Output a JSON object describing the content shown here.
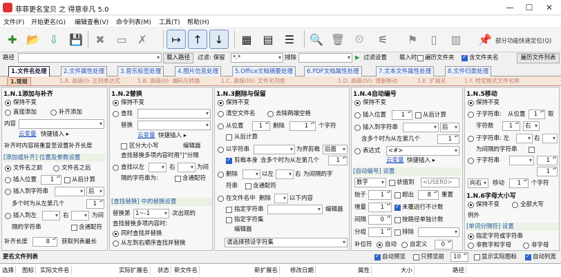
{
  "title": "菲菲更名宝贝 之 得意非凡 5.0",
  "menu": [
    "文件(F)",
    "开始更名(G)",
    "编辑查看(V)",
    "命令列表(M)",
    "工具(T)",
    "帮助(H)"
  ],
  "toolbar_right": "部分功能快速定位(Q)",
  "path": {
    "label": "路径",
    "value": "",
    "load": "载入路径",
    "filter_label": "过滤: 保留",
    "filter_value": "*.*",
    "exclude_label": "排除",
    "filter_settings": "过滤设置",
    "load_time": "载入时:",
    "opt1": "遍历文件夹",
    "opt2": "含文件夹名",
    "list_btn": "遍历文件列表"
  },
  "tabs1": [
    "1.文件名处理",
    "2.文件属性处理",
    "3.音乐标签处理",
    "4.图片信息处理",
    "5.Office文档摘要处理",
    "6.PDF文档属性处理",
    "7.文本文件属性处理",
    "8.文件归类处理"
  ],
  "tabs2": [
    "1.常规",
    "1.A. 高级(I): 正则表达式",
    "1.B. 高级(II): 编码与转换",
    "1.C. 高级(III): 文件名列表",
    "1.D. 高级(IV): 增删移动",
    "1.E. 扩展名",
    "1.F. 特定格式文件名称"
  ],
  "p1": {
    "h": "1.N.1添加与补齐",
    "r1": "保持不变",
    "r2": "直接添加",
    "r3": "补齐添加",
    "content": "内容",
    "link": "云变量",
    "quick": "快捷插入 ▸",
    "note": "补齐时内容将重复至设置补齐长度",
    "sec": "[添加或补齐] 位置及参数设置",
    "pos1": "文件名之前",
    "pos2": "文件名之后",
    "ins_pos": "插入位置",
    "v1": "1",
    "from_calc": "从后计算",
    "ins_str": "插入到字符串",
    "after": "后",
    "multi": "多个时为从左第几个",
    "v2": "1",
    "ins_to": "插入到左",
    "right": "右",
    "interval": "隔的字符串",
    "regex": "含通配符",
    "pad_len": "补齐长度",
    "v3": "8",
    "get_max": "获取列表最长"
  },
  "p2": {
    "h": "1.N.2替换",
    "r1": "保持不变",
    "r2": "查找",
    "rep": "替换",
    "link": "云变量",
    "quick": "快捷插入 ▸",
    "case": "区分大小写",
    "editor": "编辑器",
    "multi": "查找替换多项内容时用\"|\"分隔",
    "find_left": "查找以左",
    "right": "右",
    "interval_for": "为间",
    "interval": "隔的字符串为:",
    "regex": "含通配符",
    "sec": "[查找替换] 中的替换设置",
    "rep_n": "替换第",
    "rep_v": "1~-1",
    "times": "次出现的",
    "multi2": "查找替换多项内容时:",
    "o1": "同时查找并替换",
    "o2": "从左到右顺序查找并替换"
  },
  "p3": {
    "h": "1.N.3删除与保留",
    "r1": "保持不变",
    "c1": "清空文件名",
    "c2": "去除两端空格",
    "from_pos": "从位置",
    "v1": "1",
    "del": "删除",
    "v2": "1",
    "chars": "个字符",
    "from_end": "从后计算",
    "by_str": "以字符串",
    "boundary": "为界剪裁",
    "after": "后面",
    "cut": "剪裁本身",
    "multi": "含多个时为从左第几个",
    "v3": "1",
    "del2": "删除",
    "to": "以左",
    "right": "右",
    "interval": "为间隔的字",
    "str": "符串",
    "regex": "含通配符",
    "in_name": "在文件名中",
    "del3": "删除",
    "contents": "以下内容",
    "specify": "指定字符串",
    "editor": "编辑器",
    "spec_char": "指定字符集",
    "editor2": "编辑器",
    "choose": "请选择预设字符集"
  },
  "p4": {
    "h": "1.N.4自动编号",
    "r1": "保持不变",
    "r2": "插入位置",
    "v1": "1",
    "from_end": "从后计算",
    "r3": "插入到字符串",
    "after": "后",
    "multi": "含多个时为从左第几个",
    "v2": "1",
    "r4": "表达式",
    "expr": "<#>",
    "link": "云变量",
    "quick": "快捷插入 ▸",
    "sec": "[自动编号] 设置",
    "type": "数字",
    "expr2": "状值到",
    "userexpr": "<USER0>",
    "start": "始于",
    "sv": "1",
    "digits": "超出",
    "dv": "8",
    "overlap": "重置",
    "step": "增量",
    "stv": "1",
    "keep": "未覆远行不计数",
    "inc": "间隔",
    "iv": "0",
    "by_path": "按路径单独计数",
    "group": "分组",
    "gv": "1",
    "ex": "排除",
    "pad": "补位符",
    "auto": "自动",
    "custom": "自定义",
    "cv": "0"
  },
  "p5": {
    "h": "1.N.5移动",
    "r1": "保持不变",
    "r2": "子字符串:",
    "from_pos": "从位置",
    "v1": "1",
    "take": "取",
    "count": "字符数",
    "v2": "1",
    "to": "右",
    "r3": "子字符串: 左",
    "right": "右",
    "interval": "为间隔的字符串",
    "r4": "子字符串",
    "v4": "1",
    "v5": "1",
    "dir": "向右",
    "move": "移动",
    "mv": "1",
    "chars": "个字符",
    "h2": "1.N.6字母大小写",
    "c1": "保持不变",
    "c2": "全部大写",
    "except": "例外",
    "sec": "[单词分隔符] 设置",
    "spec": "指定字符或字符串",
    "nonnum": "非数字和字母",
    "nonchar": "非字母"
  },
  "bottom": {
    "title": "更名文件列表",
    "auto_preview": "自动预览",
    "preview_only": "只预览前",
    "pv": "10",
    "show_path": "显示实际图标",
    "auto_list": "自动列宽"
  },
  "columns": [
    "选择",
    "图标",
    "实际文件名",
    "实际扩展名",
    "状态",
    "新文件名",
    "新扩展名",
    "修改日期",
    "属性",
    "大小",
    "路径"
  ]
}
